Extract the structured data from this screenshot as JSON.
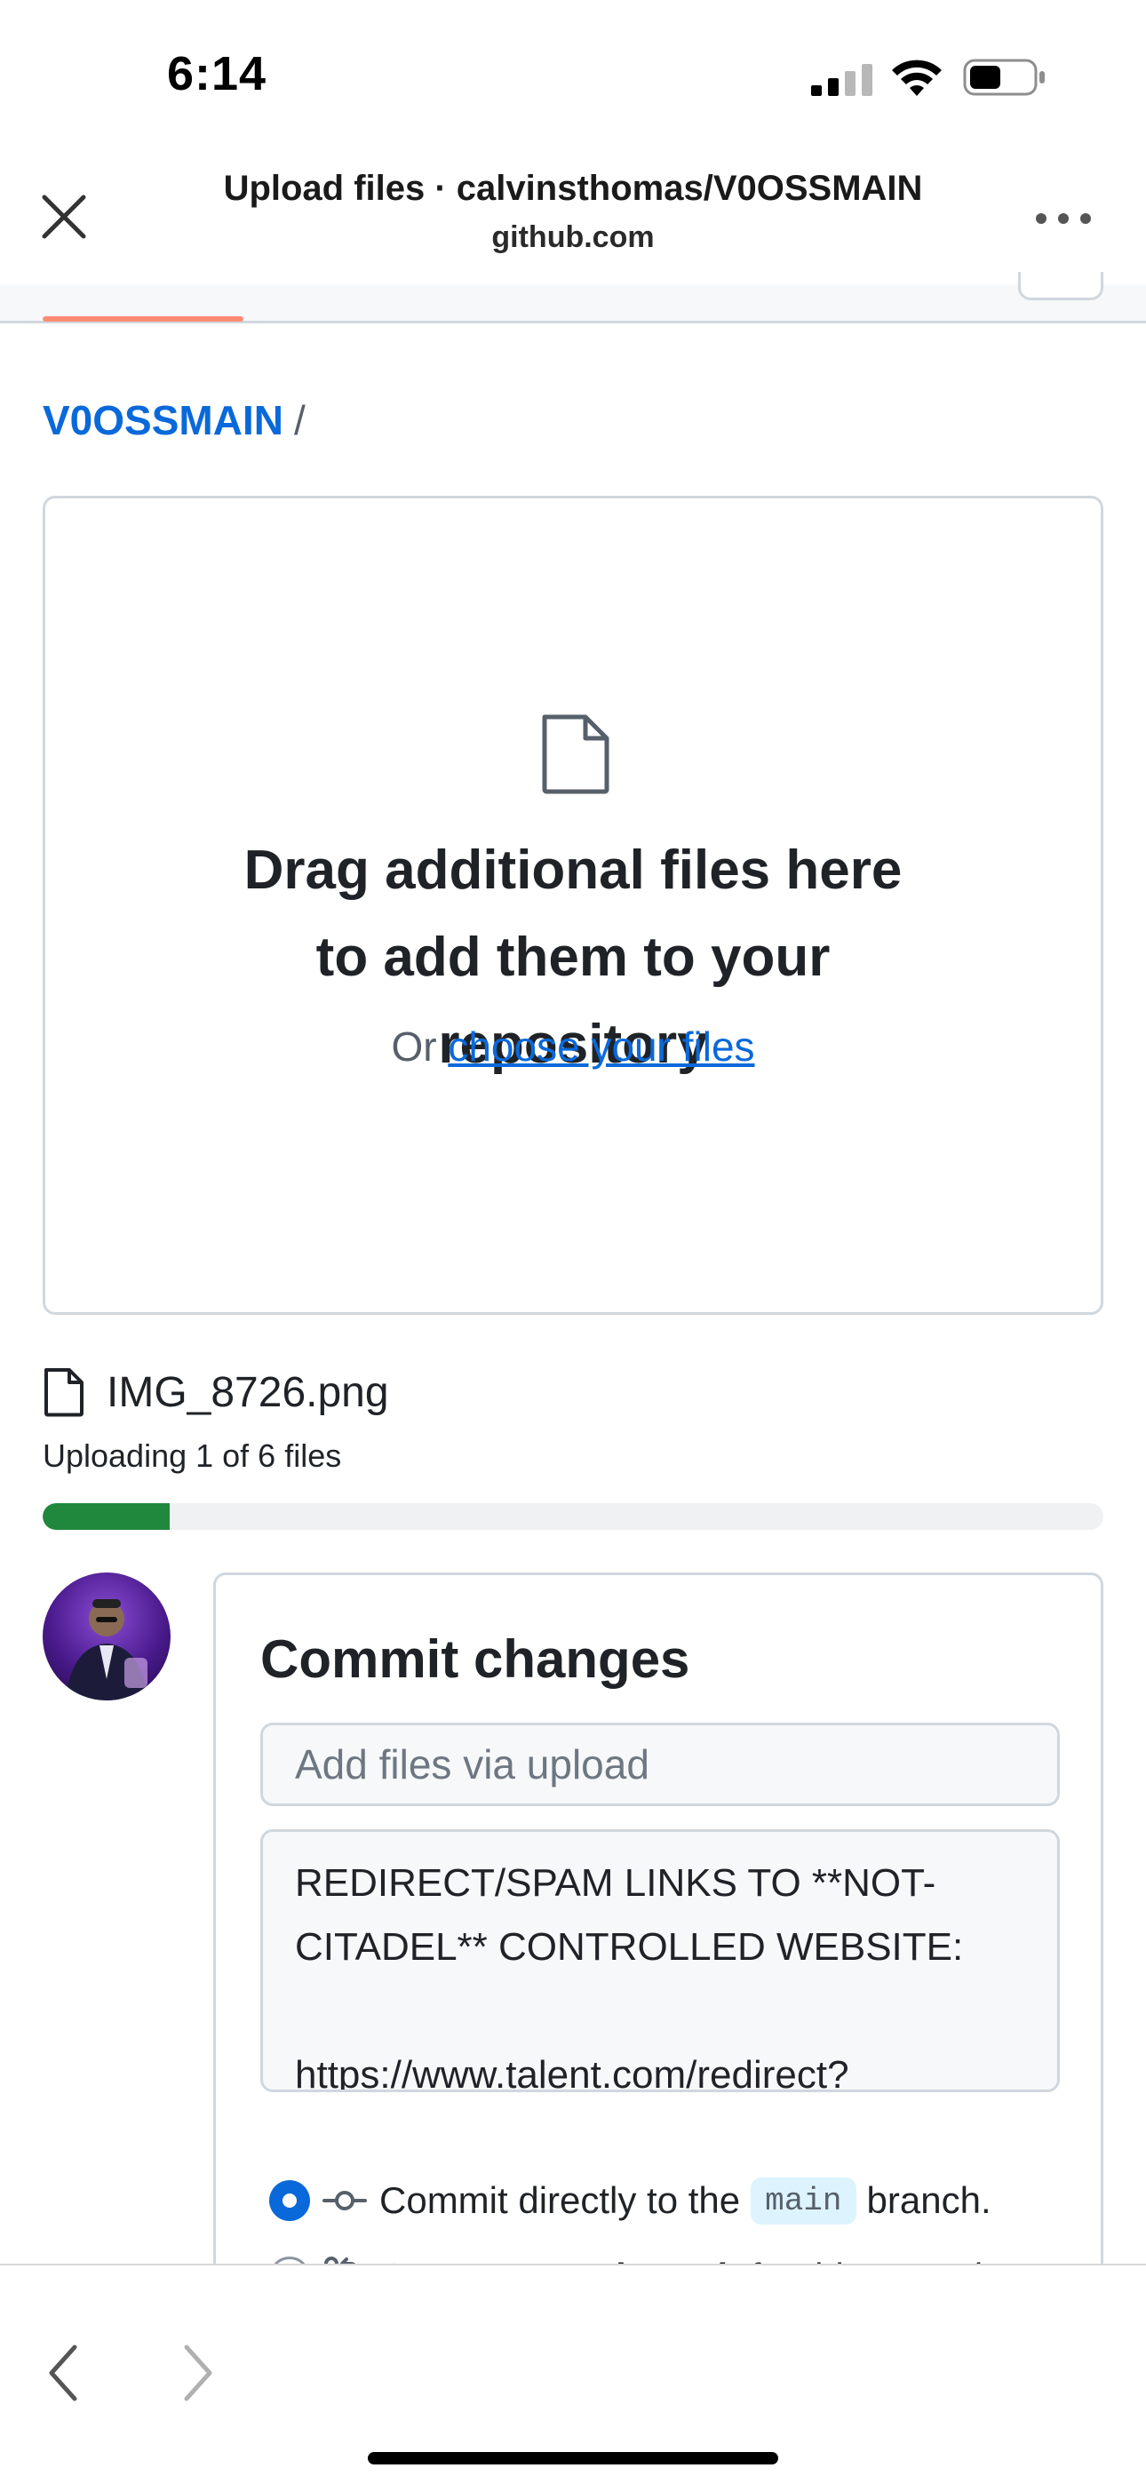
{
  "status_bar": {
    "time": "6:14",
    "icons": [
      "signal-icon",
      "wifi-icon",
      "battery-icon"
    ]
  },
  "browser": {
    "title": "Upload files · calvinsthomas/V0OSSMAIN",
    "domain": "github.com",
    "icons": [
      "close-icon",
      "more-icon"
    ]
  },
  "breadcrumb": {
    "repo": "V0OSSMAIN",
    "separator": "/"
  },
  "drop_zone": {
    "title": "Drag additional files here to add them to your repository",
    "prefix": "Or",
    "link": "choose your files",
    "icon": "file-icon"
  },
  "upload": {
    "file_name": "IMG_8726.png",
    "status": "Uploading 1 of 6 files",
    "progress_percent": 12
  },
  "commit": {
    "title": "Commit changes",
    "summary_placeholder": "Add files via upload",
    "description": "REDIRECT/SPAM LINKS TO **NOT-CITADEL** CONTROLLED WEBSITE:\n\nhttps://www.talent.com/redirect?",
    "option_direct_prefix": "Commit directly to the",
    "option_direct_branch": "main",
    "option_direct_suffix": "branch.",
    "option_new_prefix": "Create a",
    "option_new_bold": "new branch",
    "option_new_suffix": "for this commit",
    "selected_option": "direct"
  },
  "colors": {
    "link": "#0969da",
    "progress": "#1f883d",
    "tab_accent": "#fd8c73"
  },
  "bottom_nav": {
    "icons": [
      "back-icon",
      "forward-icon"
    ]
  }
}
